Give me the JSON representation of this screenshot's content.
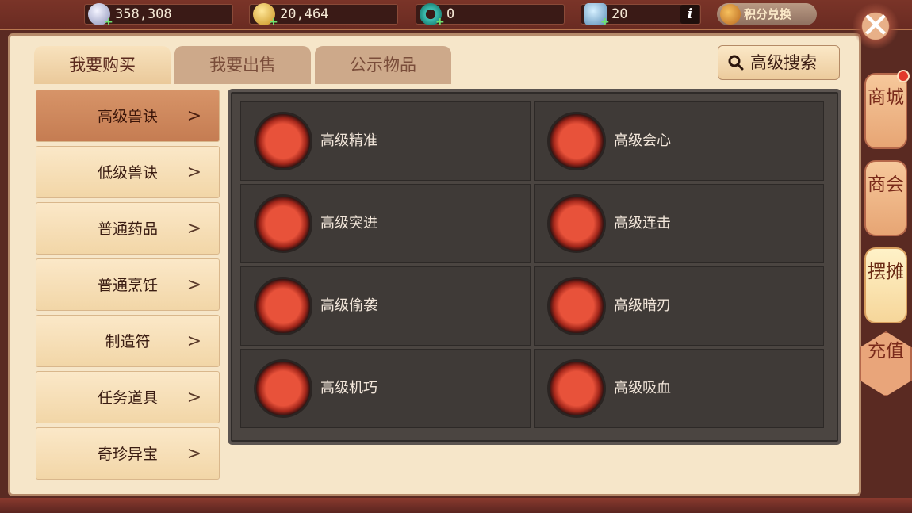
{
  "currencies": [
    {
      "icon": "silver-coin-icon",
      "value": "358,308"
    },
    {
      "icon": "gold-coin-icon",
      "value": "20,464"
    },
    {
      "icon": "jade-icon",
      "value": "0"
    },
    {
      "icon": "ticket-icon",
      "value": "20"
    }
  ],
  "topbar": {
    "info_label": "i",
    "exchange_label": "积分兑换",
    "close_label": "✕"
  },
  "tabs": [
    {
      "label": "我要购买",
      "active": true
    },
    {
      "label": "我要出售",
      "active": false
    },
    {
      "label": "公示物品",
      "active": false
    }
  ],
  "search_label": "高级搜索",
  "categories": [
    {
      "label": "高级兽诀",
      "selected": true
    },
    {
      "label": "低级兽诀",
      "selected": false
    },
    {
      "label": "普通药品",
      "selected": false
    },
    {
      "label": "普通烹饪",
      "selected": false
    },
    {
      "label": "制造符",
      "selected": false
    },
    {
      "label": "任务道具",
      "selected": false
    },
    {
      "label": "奇珍异宝",
      "selected": false
    }
  ],
  "items": [
    {
      "label": "高级精准",
      "icon": "precision-skill-icon"
    },
    {
      "label": "高级会心",
      "icon": "critical-skill-icon"
    },
    {
      "label": "高级突进",
      "icon": "charge-skill-icon"
    },
    {
      "label": "高级连击",
      "icon": "combo-skill-icon"
    },
    {
      "label": "高级偷袭",
      "icon": "ambush-skill-icon"
    },
    {
      "label": "高级暗刃",
      "icon": "dark-blade-skill-icon"
    },
    {
      "label": "高级机巧",
      "icon": "ingenuity-skill-icon"
    },
    {
      "label": "高级吸血",
      "icon": "lifesteal-skill-icon"
    }
  ],
  "right_tabs": [
    {
      "label": "商城",
      "active": false
    },
    {
      "label": "商会",
      "active": false
    },
    {
      "label": "摆摊",
      "active": true
    }
  ],
  "recharge_label": "充值",
  "colors": {
    "accent": "#c57c52",
    "panel_bg": "#f6e6c9",
    "grid_bg": "#4b4541",
    "frame": "#5a2a22"
  }
}
